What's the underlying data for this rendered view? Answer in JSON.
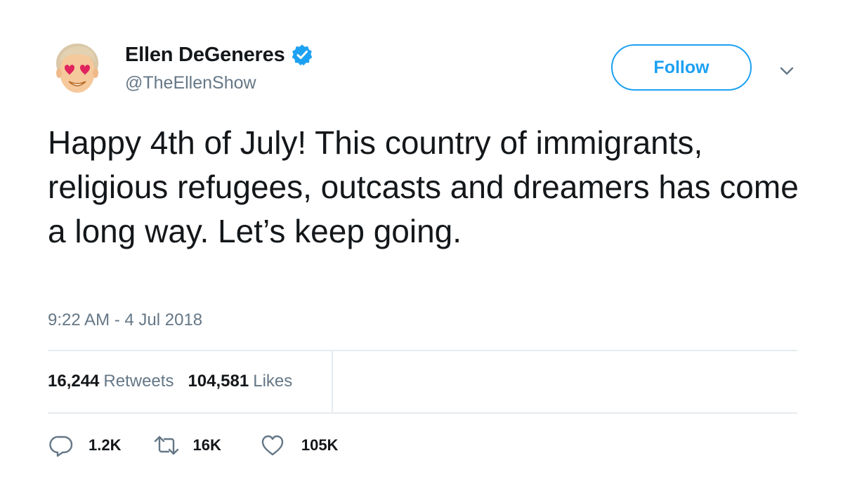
{
  "author": {
    "display_name": "Ellen DeGeneres",
    "handle": "@TheEllenShow",
    "verified_icon": "verified-badge-icon",
    "avatar_icon": "heart-eyes-emoji-avatar"
  },
  "header": {
    "follow_label": "Follow",
    "menu_icon": "chevron-down-icon"
  },
  "tweet": {
    "text": "Happy 4th of July! This country of immigrants, religious refugees, outcasts and dreamers has come a long way. Let’s keep going.",
    "timestamp": "9:22 AM - 4 Jul 2018"
  },
  "stats": {
    "retweets_count": "16,244",
    "retweets_label": "Retweets",
    "likes_count": "104,581",
    "likes_label": "Likes"
  },
  "actions": {
    "reply_count": "1.2K",
    "retweet_count": "16K",
    "like_count": "105K"
  },
  "colors": {
    "accent": "#1da1f2",
    "text": "#14171a",
    "secondary_text": "#657786",
    "divider": "#e6ecf0"
  }
}
